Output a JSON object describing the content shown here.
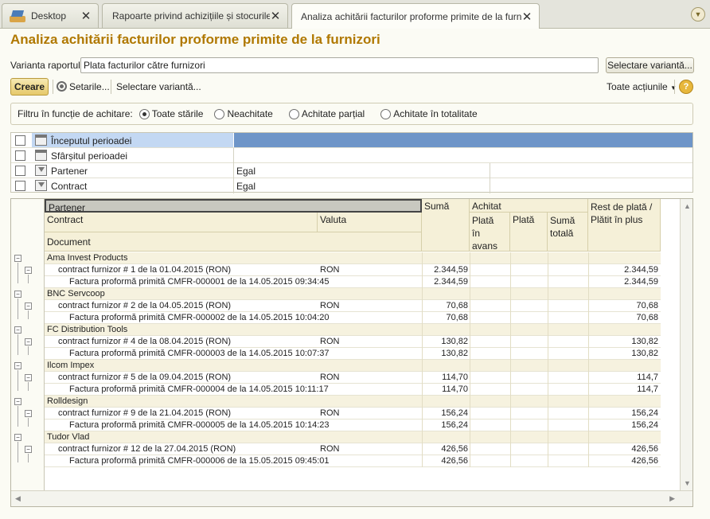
{
  "tabs": [
    {
      "label": "Desktop"
    },
    {
      "label": "Rapoarte privind achizițiile și stocurile"
    },
    {
      "label": "Analiza achitării facturilor proforme primite de la furnizori"
    }
  ],
  "title": "Analiza achitării facturilor proforme primite de la furnizori",
  "variant": {
    "label": "Varianta raportului:",
    "value": "Plata facturilor către furnizori",
    "select_button": "Selectare variantă..."
  },
  "toolbar": {
    "create": "Creare",
    "settings": "Setarile...",
    "select_variant": "Selectare variantă...",
    "all_actions": "Toate acțiunile",
    "help": "?"
  },
  "filter": {
    "label": "Filtru în funcție de achitare:",
    "options": [
      {
        "label": "Toate stările",
        "selected": true
      },
      {
        "label": "Neachitate",
        "selected": false
      },
      {
        "label": "Achitate parțial",
        "selected": false
      },
      {
        "label": "Achitate în totalitate",
        "selected": false
      }
    ]
  },
  "params": [
    {
      "name": "Începutul perioadei",
      "value": "",
      "icon": "calendar-icon"
    },
    {
      "name": "Sfârșitul perioadei",
      "value": "",
      "icon": "calendar-icon"
    },
    {
      "name": "Partener",
      "value": "Egal",
      "icon": "filter-icon"
    },
    {
      "name": "Contract",
      "value": "Egal",
      "icon": "filter-icon"
    }
  ],
  "report": {
    "headers": {
      "partner": "Partener",
      "contract": "Contract",
      "currency": "Valuta",
      "document": "Document",
      "sum": "Sumă",
      "paid": "Achitat",
      "advance": "Plată în avans",
      "payment": "Plată",
      "total": "Sumă totală",
      "rest": "Rest de plată / Plătit în plus"
    },
    "groups": [
      {
        "partner": "Ama Invest Products",
        "contract": "contract furnizor # 1 de la 01.04.2015 (RON)",
        "currency": "RON",
        "sum": "2.344,59",
        "rest": "2.344,59",
        "document": "Factura proformă primită CMFR-000001 de la 14.05.2015 09:34:45",
        "doc_sum": "2.344,59",
        "doc_rest": "2.344,59"
      },
      {
        "partner": "BNC Servcoop",
        "contract": "contract furnizor # 2 de la 04.05.2015 (RON)",
        "currency": "RON",
        "sum": "70,68",
        "rest": "70,68",
        "document": "Factura proformă primită CMFR-000002 de la 14.05.2015 10:04:20",
        "doc_sum": "70,68",
        "doc_rest": "70,68"
      },
      {
        "partner": "FC Distribution Tools",
        "contract": "contract furnizor # 4 de la 08.04.2015 (RON)",
        "currency": "RON",
        "sum": "130,82",
        "rest": "130,82",
        "document": "Factura proformă primită CMFR-000003 de la 14.05.2015 10:07:37",
        "doc_sum": "130,82",
        "doc_rest": "130,82"
      },
      {
        "partner": "Ilcom Impex",
        "contract": "contract furnizor # 5 de la 09.04.2015 (RON)",
        "currency": "RON",
        "sum": "114,70",
        "rest": "114,7",
        "document": "Factura proformă primită CMFR-000004 de la 14.05.2015 10:11:17",
        "doc_sum": "114,70",
        "doc_rest": "114,7"
      },
      {
        "partner": "Rolldesign",
        "contract": "contract furnizor # 9 de la 21.04.2015 (RON)",
        "currency": "RON",
        "sum": "156,24",
        "rest": "156,24",
        "document": "Factura proformă primită CMFR-000005 de la 14.05.2015 10:14:23",
        "doc_sum": "156,24",
        "doc_rest": "156,24"
      },
      {
        "partner": "Tudor Vlad",
        "contract": "contract furnizor # 12 de la 27.04.2015 (RON)",
        "currency": "RON",
        "sum": "426,56",
        "rest": "426,56",
        "document": "Factura proformă primită CMFR-000006 de la 15.05.2015 09:45:01",
        "doc_sum": "426,56",
        "doc_rest": "426,56"
      }
    ]
  }
}
